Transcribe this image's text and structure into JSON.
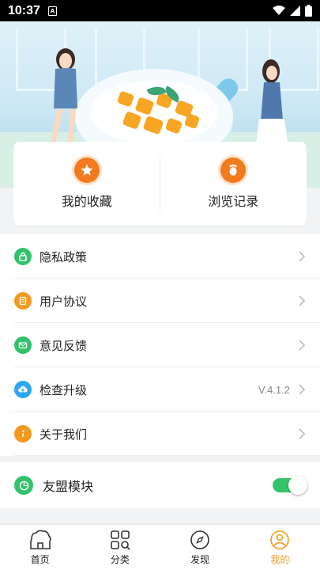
{
  "status_bar": {
    "time": "10:37",
    "sim_label": "A"
  },
  "favorites": [
    {
      "label": "我的收藏",
      "icon": "star-icon"
    },
    {
      "label": "浏览记录",
      "icon": "footprint-icon"
    }
  ],
  "menu": [
    {
      "label": "隐私政策",
      "icon": "lock-icon",
      "color": "#33c16b"
    },
    {
      "label": "用户协议",
      "icon": "document-icon",
      "color": "#f39a1e"
    },
    {
      "label": "意见反馈",
      "icon": "mail-icon",
      "color": "#33c16b"
    },
    {
      "label": "检查升级",
      "icon": "cloud-upload-icon",
      "color": "#2aa7ef",
      "version": "V.4.1.2"
    },
    {
      "label": "关于我们",
      "icon": "info-icon",
      "color": "#f39a1e"
    }
  ],
  "umeng": {
    "label": "友盟模块",
    "icon": "pie-chart-icon",
    "color": "#33c16b",
    "enabled": true
  },
  "tabs": [
    {
      "label": "首页",
      "icon": "home-icon",
      "active": false
    },
    {
      "label": "分类",
      "icon": "category-icon",
      "active": false
    },
    {
      "label": "发现",
      "icon": "compass-icon",
      "active": false
    },
    {
      "label": "我的",
      "icon": "profile-icon",
      "active": true
    }
  ],
  "colors": {
    "accent": "#f39a1e",
    "green": "#33c16b",
    "blue": "#2aa7ef",
    "toggle_on": "#34c36b"
  }
}
